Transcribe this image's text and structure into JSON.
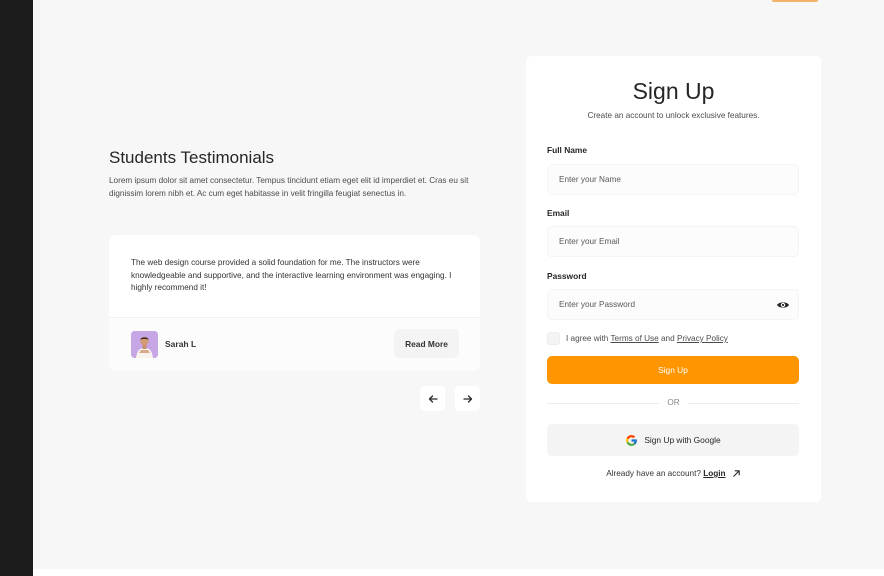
{
  "testimonials": {
    "title": "Students Testimonials",
    "description": "Lorem ipsum dolor sit amet consectetur. Tempus tincidunt etiam eget elit id imperdiet et. Cras eu sit dignissim lorem nibh et. Ac cum eget habitasse in velit fringilla feugiat senectus in.",
    "card": {
      "quote": "The web design course provided a solid foundation for me. The instructors were knowledgeable and supportive, and the interactive learning environment was engaging. I highly recommend it!",
      "author": "Sarah L",
      "read_more_label": "Read More"
    },
    "nav": {
      "prev_icon": "arrow-left-icon",
      "next_icon": "arrow-right-icon"
    }
  },
  "signup": {
    "title": "Sign Up",
    "subtitle": "Create an account to unlock exclusive features.",
    "fields": {
      "name": {
        "label": "Full Name",
        "placeholder": "Enter your Name",
        "value": ""
      },
      "email": {
        "label": "Email",
        "placeholder": "Enter your Email",
        "value": ""
      },
      "password": {
        "label": "Password",
        "placeholder": "Enter your Password",
        "value": "",
        "icon": "eye-icon"
      }
    },
    "agree": {
      "prefix": "I agree with",
      "terms": "Terms of Use",
      "and": "and",
      "privacy": "Privacy Policy",
      "checked": false
    },
    "submit_label": "Sign Up",
    "divider": "OR",
    "google_label": "Sign Up with Google",
    "login_prompt": "Already have an account?",
    "login_link": "Login"
  },
  "colors": {
    "accent": "#ff9500",
    "sidebar": "#1c1c1c",
    "background": "#f7f7f8",
    "card": "#ffffff"
  }
}
